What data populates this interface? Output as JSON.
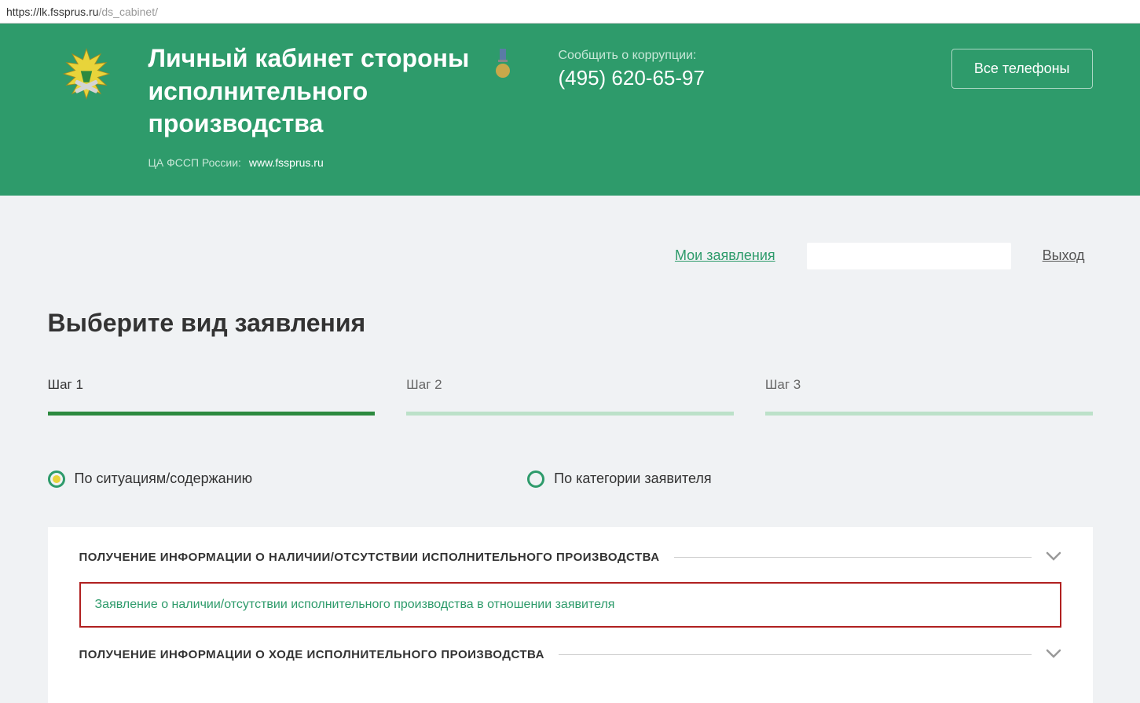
{
  "url": {
    "host": "https://lk.fssprus.ru",
    "path": "/ds_cabinet/"
  },
  "header": {
    "title": "Личный кабинет стороны исполнительного производства",
    "org_label": "ЦА ФССП России:",
    "org_domain": "www.fssprus.ru",
    "corruption_label": "Сообщить о коррупции:",
    "phone": "(495) 620-65-97",
    "all_phones": "Все телефоны"
  },
  "nav": {
    "my_applications": "Мои заявления",
    "logout": "Выход"
  },
  "page": {
    "title": "Выберите вид заявления",
    "steps": [
      "Шаг 1",
      "Шаг 2",
      "Шаг 3"
    ],
    "filters": {
      "by_content": "По ситуациям/содержанию",
      "by_category": "По категории заявителя"
    },
    "sections": [
      {
        "title": "ПОЛУЧЕНИЕ ИНФОРМАЦИИ О НАЛИЧИИ/ОТСУТСТВИИ ИСПОЛНИТЕЛЬНОГО ПРОИЗВОДСТВА",
        "highlighted_item": "Заявление о наличии/отсутствии исполнительного производства в отношении заявителя"
      },
      {
        "title": "ПОЛУЧЕНИЕ ИНФОРМАЦИИ О ХОДЕ ИСПОЛНИТЕЛЬНОГО ПРОИЗВОДСТВА"
      }
    ]
  },
  "colors": {
    "brand_green": "#2e9b6b",
    "step_active": "#2c8a3f",
    "highlight_border": "#b02020"
  }
}
